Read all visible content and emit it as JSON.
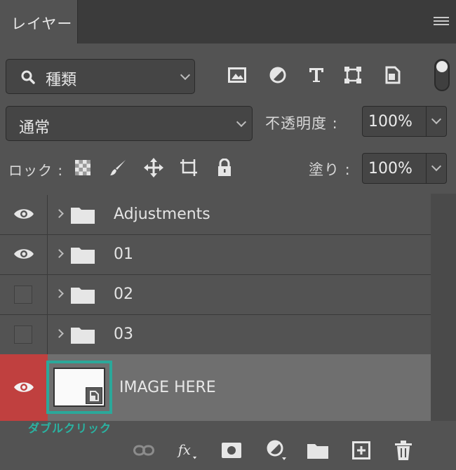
{
  "panel": {
    "tab_label": "レイヤー"
  },
  "filter": {
    "kind_label": "種類"
  },
  "blend": {
    "mode_label": "通常",
    "opacity_label": "不透明度 :",
    "opacity_value": "100%"
  },
  "lock": {
    "label": "ロック :",
    "fill_label": "塗り :",
    "fill_value": "100%"
  },
  "layers": [
    {
      "name": "Adjustments",
      "visible": true
    },
    {
      "name": "01",
      "visible": true
    },
    {
      "name": "02",
      "visible": false
    },
    {
      "name": "03",
      "visible": false
    }
  ],
  "image_layer": {
    "name": "IMAGE HERE",
    "selected": true
  },
  "annotation": {
    "hint": "ダブルクリック"
  },
  "colors": {
    "selected_visibility": "#c0403f",
    "thumbnail_highlight": "#2ba89a",
    "hint_text": "#2ab3a2"
  }
}
